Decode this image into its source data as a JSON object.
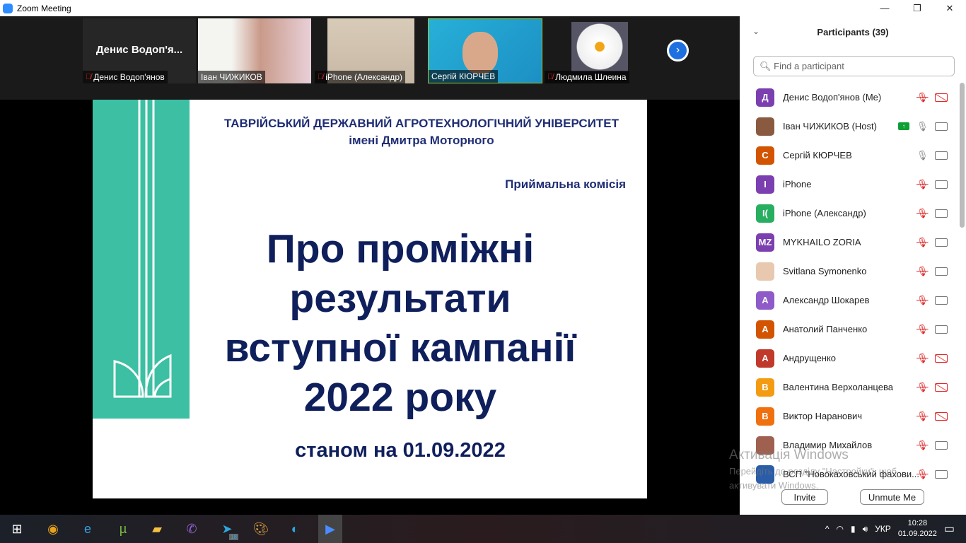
{
  "window": {
    "title": "Zoom Meeting",
    "minimize": "—",
    "maximize": "❐",
    "close": "✕"
  },
  "videos": [
    {
      "label": "Денис Водоп'янов",
      "big_name": "Денис  Водоп'я...",
      "muted": true
    },
    {
      "label": "Іван ЧИЖИКОВ",
      "muted": false
    },
    {
      "label": "iPhone (Александр)",
      "muted": true
    },
    {
      "label": "Сергій КЮРЧЕВ",
      "muted": false,
      "active": true
    },
    {
      "label": "Людмила Шлеина",
      "muted": true
    }
  ],
  "slide": {
    "university": "ТАВРІЙСЬКИЙ ДЕРЖАВНИЙ АГРОТЕХНОЛОГІЧНИЙ УНІВЕРСИТЕТ",
    "university_sub": "імені Дмитра Моторного",
    "committee": "Приймальна комісія",
    "title_lines": [
      "Про проміжні",
      "результати",
      "вступної кампанії",
      "2022 року"
    ],
    "date": "станом на 01.09.2022"
  },
  "participants": {
    "header": "Participants (39)",
    "search_placeholder": "Find a participant",
    "list": [
      {
        "initials": "Д",
        "color": "#7b3fb0",
        "name": "Денис Водоп'янов (Me)",
        "mic": "off",
        "cam": "off"
      },
      {
        "initials": "",
        "color": "#8a5a40",
        "name": "Іван ЧИЖИКОВ (Host)",
        "mic": "on",
        "cam": "on",
        "sharing": true
      },
      {
        "initials": "С",
        "color": "#d35400",
        "name": "Сергій КЮРЧЕВ",
        "mic": "on",
        "cam": "on"
      },
      {
        "initials": "I",
        "color": "#7b3fb0",
        "name": "iPhone",
        "mic": "off",
        "cam": "on"
      },
      {
        "initials": "I(",
        "color": "#27ae60",
        "name": "iPhone (Александр)",
        "mic": "off",
        "cam": "on"
      },
      {
        "initials": "MZ",
        "color": "#7b3fb0",
        "name": "MYKHAILO ZORIA",
        "mic": "off",
        "cam": "on"
      },
      {
        "initials": "",
        "color": "#e8c9b0",
        "name": "Svitlana Symonenko",
        "mic": "off",
        "cam": "on"
      },
      {
        "initials": "А",
        "color": "#8e5bc9",
        "name": "Александр Шокарев",
        "mic": "off",
        "cam": "on"
      },
      {
        "initials": "А",
        "color": "#d35400",
        "name": "Анатолий Панченко",
        "mic": "off",
        "cam": "on"
      },
      {
        "initials": "А",
        "color": "#c0392b",
        "name": "Андрущенко",
        "mic": "off",
        "cam": "off"
      },
      {
        "initials": "В",
        "color": "#f39c12",
        "name": "Валентина Верхоланцева",
        "mic": "off",
        "cam": "off"
      },
      {
        "initials": "В",
        "color": "#f07010",
        "name": "Виктор Наранович",
        "mic": "off",
        "cam": "off"
      },
      {
        "initials": "",
        "color": "#a06050",
        "name": "Владимир Михайлов",
        "mic": "off",
        "cam": "on"
      },
      {
        "initials": "",
        "color": "#2a5ca8",
        "name": "ВСП \"Новокаховський фахови...",
        "mic": "off",
        "cam": "on"
      }
    ],
    "invite": "Invite",
    "unmute": "Unmute Me"
  },
  "watermark": {
    "line1": "Активація Windows",
    "line2": "Перейдіть до розділу \"Настройки\", щоб",
    "line3": "активувати Windows."
  },
  "taskbar": {
    "telegram_badge": "18",
    "lang": "УКР",
    "time": "10:28",
    "date": "01.09.2022"
  }
}
